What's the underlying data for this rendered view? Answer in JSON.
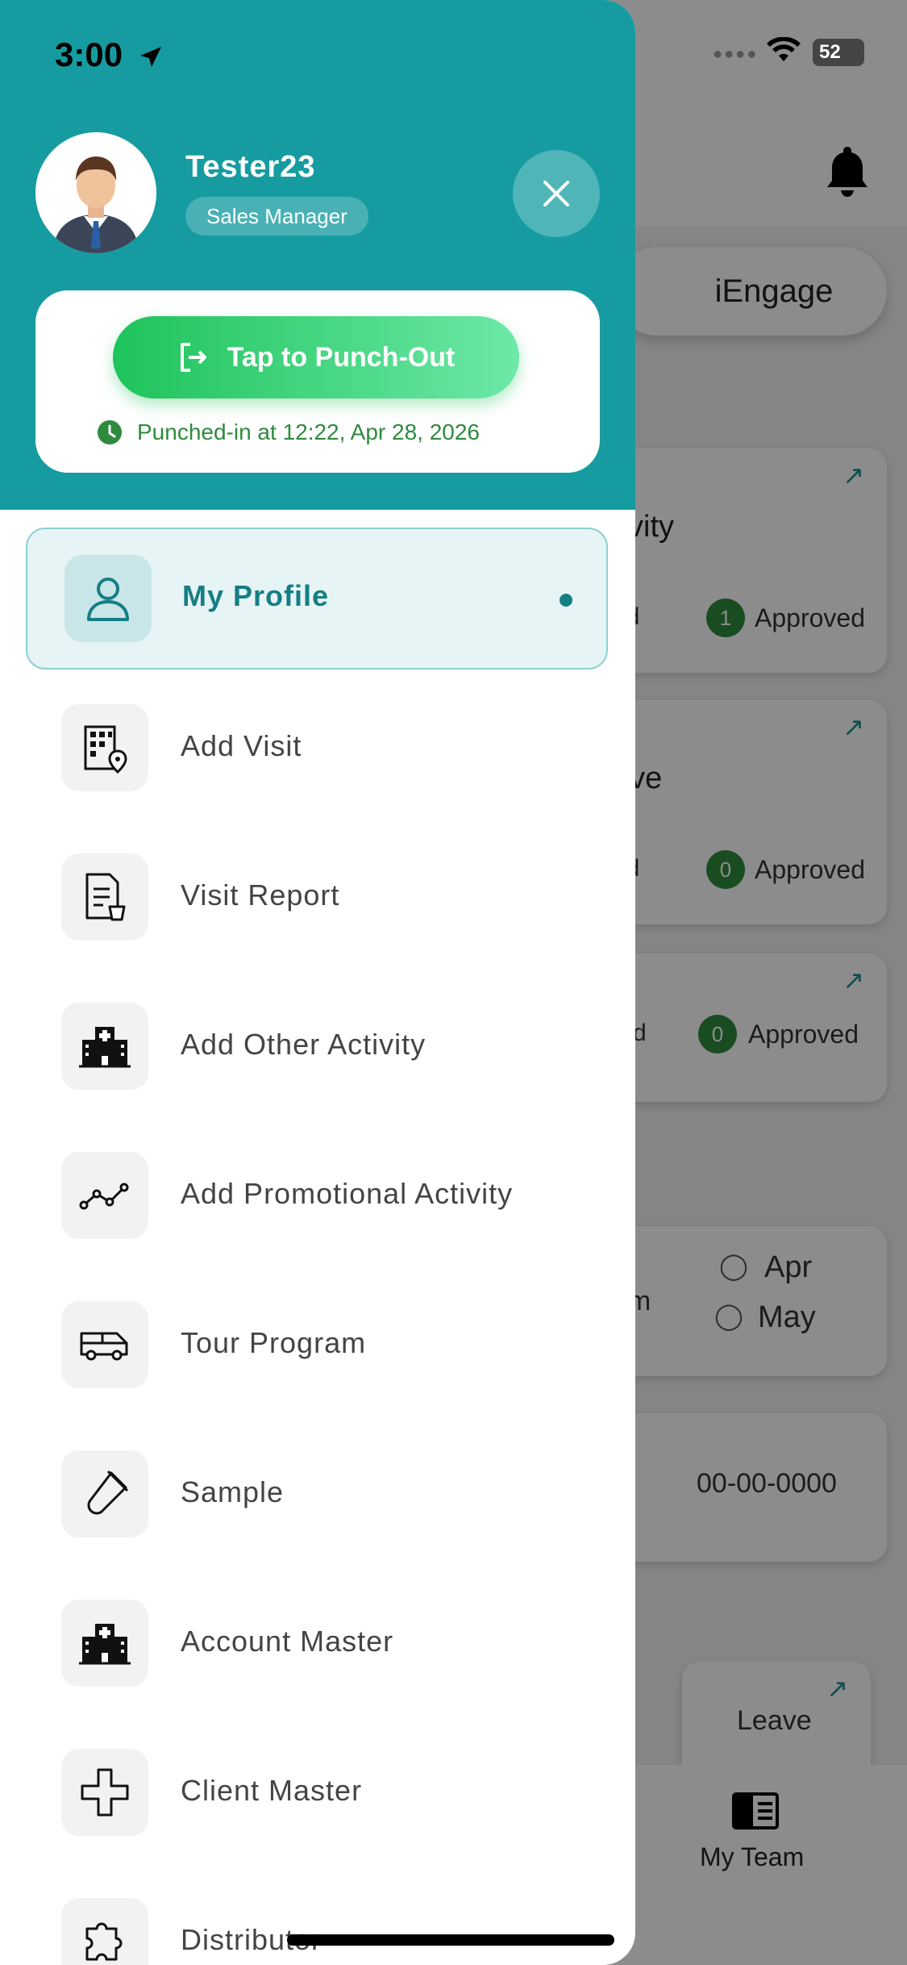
{
  "status_bar": {
    "time": "3:00",
    "battery": "52"
  },
  "background": {
    "pill_label": "iEngage",
    "cards": [
      {
        "title_fragment": "tivity",
        "left_fragment": "ed",
        "count": "1",
        "count_label": "Approved"
      },
      {
        "title_fragment": "ave",
        "left_fragment": "ed",
        "count": "0",
        "count_label": "Approved"
      },
      {
        "title_fragment": "",
        "left_fragment": "ted",
        "count": "0",
        "count_label": "Approved"
      }
    ],
    "team_card": {
      "fragment": "am",
      "months": [
        "Apr",
        "May"
      ]
    },
    "date_card": {
      "value": "00-00-0000"
    },
    "leave_card": {
      "label": "Leave"
    },
    "bottom_tab": {
      "label": "My Team"
    }
  },
  "drawer": {
    "user": {
      "name": "Tester23",
      "role": "Sales Manager"
    },
    "punch": {
      "button_label": "Tap to Punch-Out",
      "info": "Punched-in at 12:22, Apr 28, 2026"
    },
    "menu": [
      {
        "label": "My Profile",
        "icon": "person-icon"
      },
      {
        "label": "Add Visit",
        "icon": "building-location-icon"
      },
      {
        "label": "Visit Report",
        "icon": "report-icon"
      },
      {
        "label": "Add Other Activity",
        "icon": "hospital-icon"
      },
      {
        "label": "Add Promotional Activity",
        "icon": "trend-line-icon"
      },
      {
        "label": "Tour Program",
        "icon": "van-icon"
      },
      {
        "label": "Sample",
        "icon": "test-tube-icon"
      },
      {
        "label": "Account Master",
        "icon": "hospital-icon"
      },
      {
        "label": "Client Master",
        "icon": "plus-icon"
      },
      {
        "label": "Distributor",
        "icon": "puzzle-icon"
      }
    ]
  },
  "colors": {
    "primary": "#169ca0",
    "accent_green": "#1ec35a",
    "active_text": "#157e84"
  }
}
